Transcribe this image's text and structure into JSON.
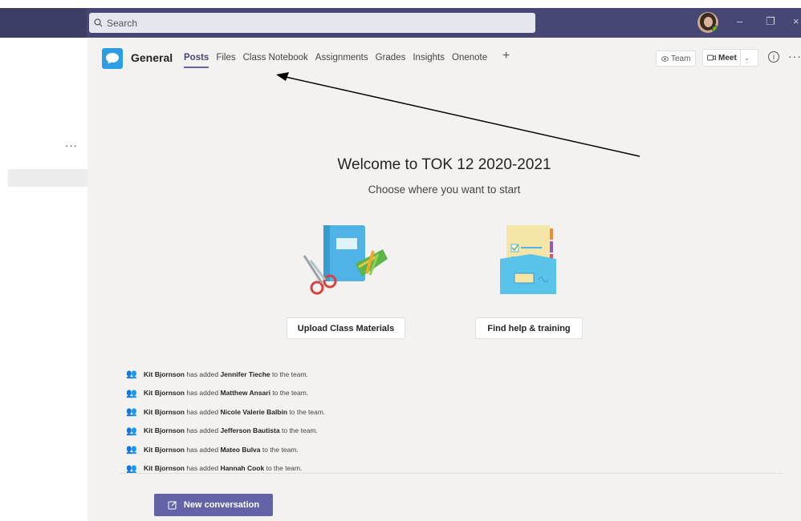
{
  "titlebar": {
    "search_placeholder": "Search",
    "minimize_glyph": "–",
    "restore_glyph": "❐",
    "close_glyph": "×"
  },
  "sidebar": {
    "more_glyph": "···"
  },
  "channel": {
    "name": "General",
    "tabs": [
      {
        "label": "Posts",
        "active": true
      },
      {
        "label": "Files"
      },
      {
        "label": "Class Notebook"
      },
      {
        "label": "Assignments"
      },
      {
        "label": "Grades"
      },
      {
        "label": "Insights"
      },
      {
        "label": "Onenote"
      }
    ],
    "add_tab_glyph": "+",
    "team_button": "Team",
    "meet_button": "Meet",
    "info_glyph": "i",
    "more_glyph": "···"
  },
  "welcome": {
    "title": "Welcome to TOK 12 2020-2021",
    "subtitle": "Choose where you want to start",
    "upload_button": "Upload Class Materials",
    "help_button": "Find help & training"
  },
  "activity": [
    {
      "actor": "Kit Bjornson",
      "verb": " has added ",
      "member": "Jennifer Tieche",
      "tail": " to the team."
    },
    {
      "actor": "Kit Bjornson",
      "verb": " has added ",
      "member": "Matthew Ansari",
      "tail": " to the team."
    },
    {
      "actor": "Kit Bjornson",
      "verb": " has added ",
      "member": "Nicole Valerie Balbin",
      "tail": " to the team."
    },
    {
      "actor": "Kit Bjornson",
      "verb": " has added ",
      "member": "Jefferson Bautista",
      "tail": " to the team."
    },
    {
      "actor": "Kit Bjornson",
      "verb": " has added ",
      "member": "Mateo Bulva",
      "tail": " to the team."
    },
    {
      "actor": "Kit Bjornson",
      "verb": " has added ",
      "member": "Hannah Cook",
      "tail": " to the team."
    }
  ],
  "compose": {
    "new_conversation_label": "New conversation"
  },
  "colors": {
    "titlebar": "#464775",
    "accent": "#6264a7",
    "canvas": "#f3f2f1"
  }
}
